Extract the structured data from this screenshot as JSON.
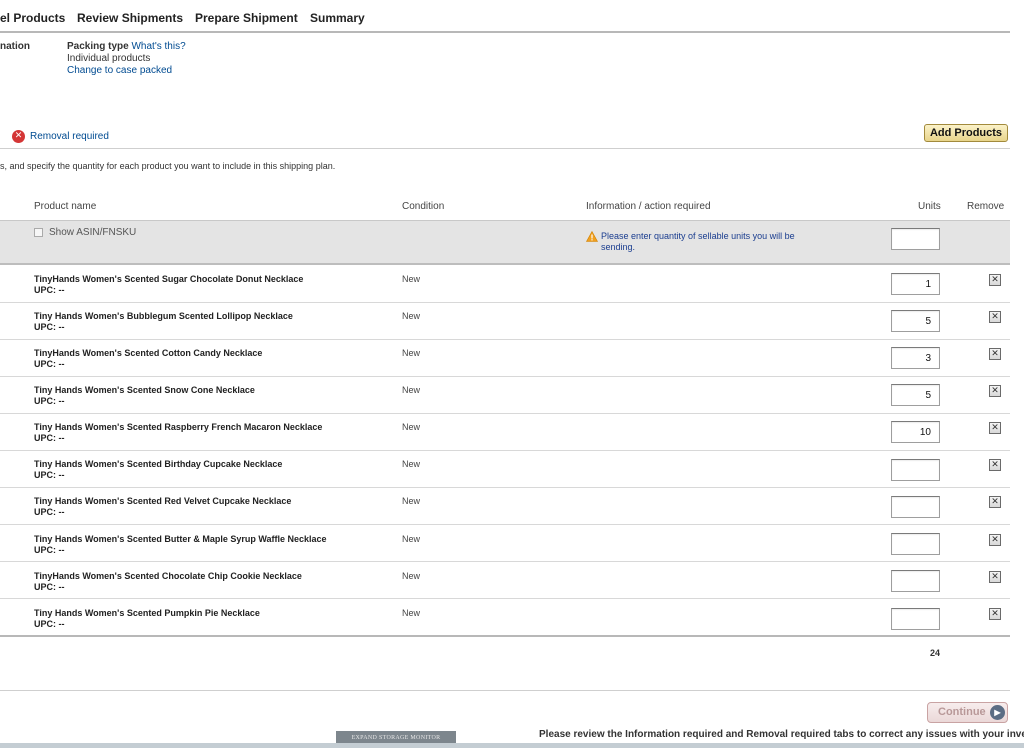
{
  "tabs": [
    "el Products",
    "Review Shipments",
    "Prepare Shipment",
    "Summary"
  ],
  "info": {
    "label": "nation",
    "packing_type": "Packing type",
    "whats_this": "What's this?",
    "value": "Individual products",
    "change_link": "Change to case packed"
  },
  "removal_required": "Removal required",
  "add_products": "Add Products",
  "instructions": "s, and specify the quantity for each product you want to include in this shipping plan.",
  "columns": {
    "product_name": "Product name",
    "condition": "Condition",
    "info": "Information / action required",
    "units": "Units",
    "remove": "Remove"
  },
  "show_asin": "Show ASIN/FNSKU",
  "warning": "Please enter quantity of sellable units you will be sending.",
  "products": [
    {
      "name": "TinyHands Women's Scented Sugar Chocolate Donut Necklace",
      "upc": "UPC: --",
      "condition": "New",
      "units": "1"
    },
    {
      "name": "Tiny Hands Women's Bubblegum Scented Lollipop Necklace",
      "upc": "UPC: --",
      "condition": "New",
      "units": "5"
    },
    {
      "name": "TinyHands Women's Scented Cotton Candy Necklace",
      "upc": "UPC: --",
      "condition": "New",
      "units": "3"
    },
    {
      "name": "Tiny Hands Women's Scented Snow Cone Necklace",
      "upc": "UPC: --",
      "condition": "New",
      "units": "5"
    },
    {
      "name": "Tiny Hands Women's Scented Raspberry French Macaron Necklace",
      "upc": "UPC: --",
      "condition": "New",
      "units": "10"
    },
    {
      "name": "Tiny Hands Women's Scented Birthday Cupcake Necklace",
      "upc": "UPC: --",
      "condition": "New",
      "units": ""
    },
    {
      "name": "Tiny Hands Women's Scented Red Velvet Cupcake Necklace",
      "upc": "UPC: --",
      "condition": "New",
      "units": ""
    },
    {
      "name": "Tiny Hands Women's Scented Butter & Maple Syrup Waffle Necklace",
      "upc": "UPC: --",
      "condition": "New",
      "units": ""
    },
    {
      "name": "TinyHands Women's Scented Chocolate Chip Cookie Necklace",
      "upc": "UPC: --",
      "condition": "New",
      "units": ""
    },
    {
      "name": "Tiny Hands Women's Scented Pumpkin Pie Necklace",
      "upc": "UPC: --",
      "condition": "New",
      "units": ""
    }
  ],
  "total_units": "24",
  "continue": "Continue",
  "review_message": "Please review the Information required and Removal required tabs to correct any issues with your inventory.",
  "storage_monitor": "EXPAND STORAGE MONITOR"
}
